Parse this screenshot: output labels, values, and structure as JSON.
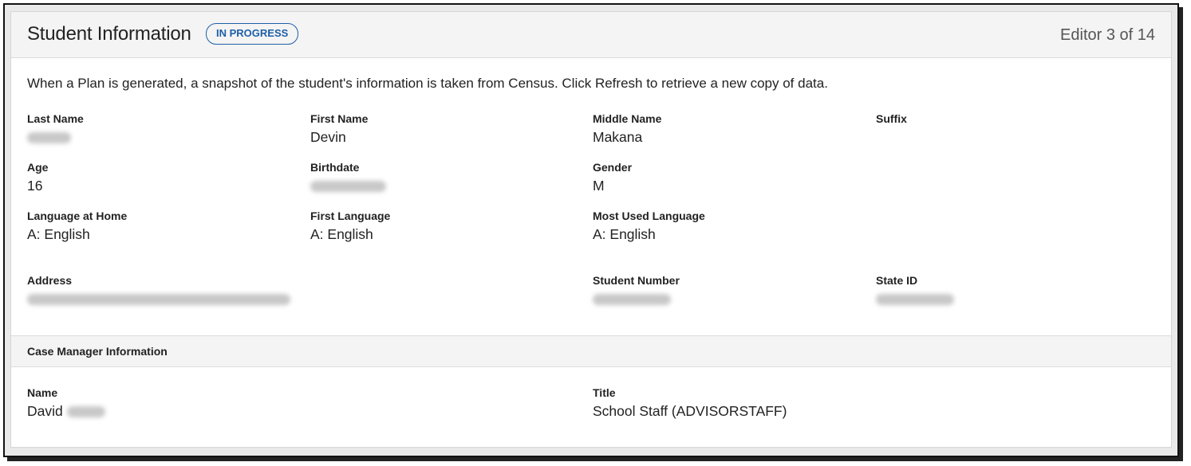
{
  "header": {
    "title": "Student Information",
    "status": "IN PROGRESS",
    "editor_position": "Editor 3 of 14"
  },
  "intro_text": "When a Plan is generated, a snapshot of the student's information is taken from Census. Click Refresh to retrieve a new copy of data.",
  "student": {
    "last_name": {
      "label": "Last Name",
      "value": ""
    },
    "first_name": {
      "label": "First Name",
      "value": "Devin"
    },
    "middle_name": {
      "label": "Middle Name",
      "value": "Makana"
    },
    "suffix": {
      "label": "Suffix",
      "value": ""
    },
    "age": {
      "label": "Age",
      "value": "16"
    },
    "birthdate": {
      "label": "Birthdate",
      "value": ""
    },
    "gender": {
      "label": "Gender",
      "value": "M"
    },
    "language_at_home": {
      "label": "Language at Home",
      "value": "A: English"
    },
    "first_language": {
      "label": "First Language",
      "value": "A: English"
    },
    "most_used_language": {
      "label": "Most Used Language",
      "value": "A: English"
    },
    "address": {
      "label": "Address",
      "value": ""
    },
    "student_number": {
      "label": "Student Number",
      "value": ""
    },
    "state_id": {
      "label": "State ID",
      "value": ""
    }
  },
  "case_manager": {
    "section_title": "Case Manager Information",
    "name": {
      "label": "Name",
      "value": "David"
    },
    "title": {
      "label": "Title",
      "value": "School Staff (ADVISORSTAFF)"
    }
  },
  "colors": {
    "badge": "#1f5fa8",
    "header_bg": "#f4f4f4",
    "text": "#222222"
  }
}
